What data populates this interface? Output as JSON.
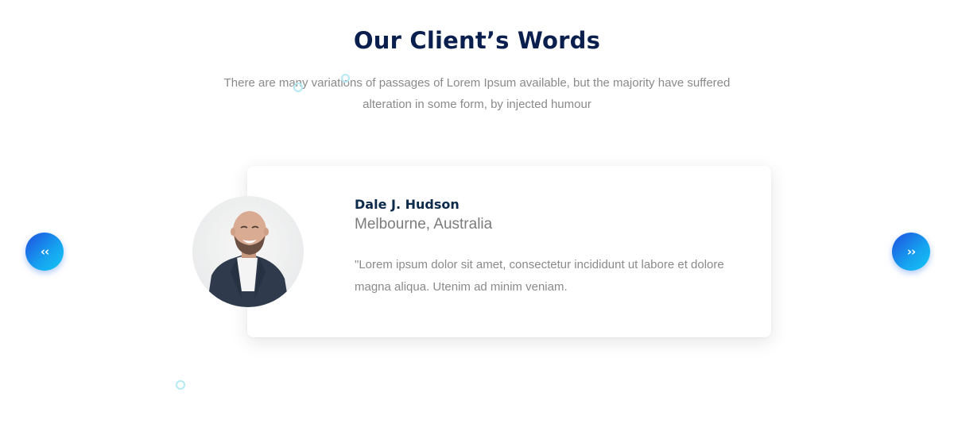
{
  "section": {
    "title": "Our Client’s Words",
    "subtitle": "There are many variations of passages of Lorem Ipsum available, but the majority have suffered alteration in some form, by injected humour"
  },
  "testimonial": {
    "name": "Dale J. Hudson",
    "location": "Melbourne, Australia",
    "quote": "\"Lorem ipsum dolor sit amet, consectetur incididunt ut labore et dolore magna aliqua. Utenim ad minim veniam.",
    "avatar_icon": "person-photo"
  },
  "navigation": {
    "prev_icon": "chevron-double-left-icon",
    "next_icon": "chevron-double-right-icon",
    "prev_glyph": "‹‹",
    "next_glyph": "››"
  },
  "colors": {
    "title": "#0b1f4e",
    "accent_start": "#1e4fe0",
    "accent_end": "#13c6f5",
    "text_muted": "#8a8a8a",
    "decor_circle": "#b4e9f5"
  }
}
